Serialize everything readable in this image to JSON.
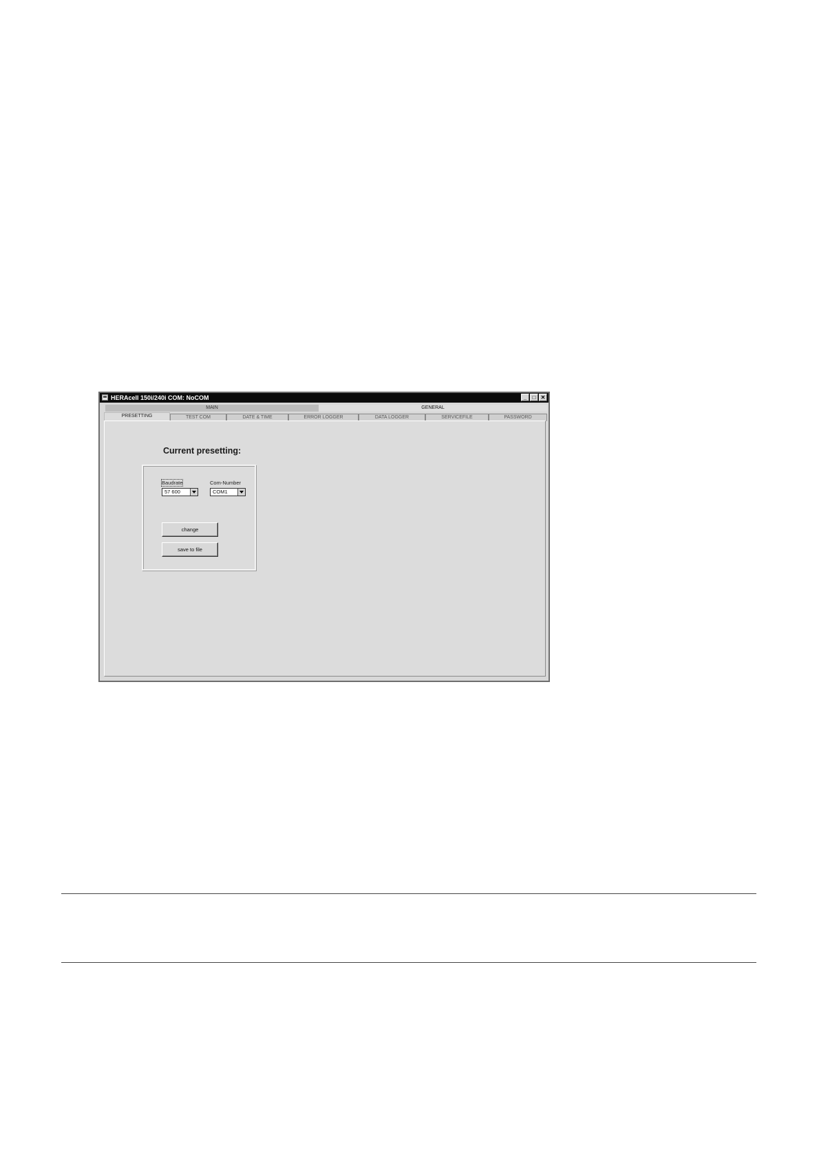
{
  "window": {
    "title": "HERAcell 150i/240i COM: NoCOM",
    "buttons": {
      "minimize": "_",
      "maximize": "□",
      "close": "✕"
    }
  },
  "groups": {
    "main": "MAIN",
    "general": "GENERAL"
  },
  "tabs": [
    {
      "label": "PRESETTING",
      "active": true
    },
    {
      "label": "TEST COM"
    },
    {
      "label": "DATE & TIME"
    },
    {
      "label": "ERROR LOGGER"
    },
    {
      "label": "DATA LOGGER"
    },
    {
      "label": "SERVICEFILE"
    },
    {
      "label": "PASSWORD"
    }
  ],
  "presetting": {
    "heading": "Current presetting:",
    "baudrate": {
      "label": "Baudrate",
      "value": "57 600"
    },
    "com_number": {
      "label": "Com-Number",
      "value": "COM1"
    },
    "change_button": "change",
    "save_button": "save to file"
  }
}
